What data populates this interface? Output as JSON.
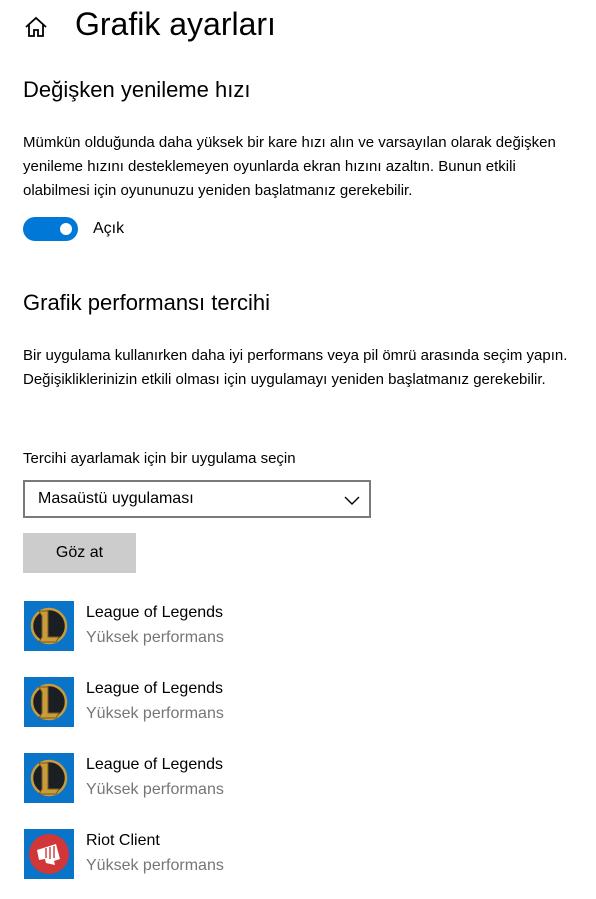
{
  "header": {
    "title": "Grafik ayarları",
    "home_icon": "home-icon"
  },
  "variable_refresh": {
    "heading": "Değişken yenileme hızı",
    "description": "Mümkün olduğunda daha yüksek bir kare hızı alın ve varsayılan olarak değişken yenileme hızını desteklemeyen oyunlarda ekran hızını azaltın. Bunun etkili olabilmesi için oyununuzu yeniden başlatmanız gerekebilir.",
    "toggle_state": "on",
    "toggle_label": "Açık"
  },
  "graphics_pref": {
    "heading": "Grafik performansı tercihi",
    "description": "Bir uygulama kullanırken daha iyi performans veya pil ömrü arasında seçim yapın. Değişikliklerinizin etkili olması için uygulamayı yeniden başlatmanız gerekebilir.",
    "select_label": "Tercihi ayarlamak için bir uygulama seçin",
    "selected_app_type": "Masaüstü uygulaması",
    "browse_label": "Göz at"
  },
  "apps": [
    {
      "name": "League of Legends",
      "preference": "Yüksek performans",
      "icon": "league-of-legends-icon"
    },
    {
      "name": "League of Legends",
      "preference": "Yüksek performans",
      "icon": "league-of-legends-icon"
    },
    {
      "name": "League of Legends",
      "preference": "Yüksek performans",
      "icon": "league-of-legends-icon"
    },
    {
      "name": "Riot Client",
      "preference": "Yüksek performans",
      "icon": "riot-client-icon"
    }
  ],
  "colors": {
    "accent": "#0078d7",
    "secondary_text": "#767676",
    "button_bg": "#cccccc",
    "lol_icon_bg": "#0a74c8",
    "lol_icon_gold": "#c89b3c",
    "riot_icon_red": "#d13639"
  }
}
